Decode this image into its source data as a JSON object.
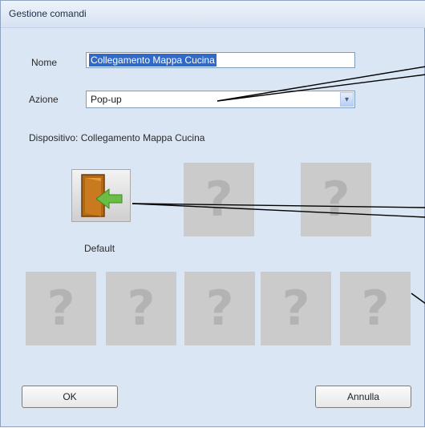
{
  "window": {
    "title": "Gestione comandi"
  },
  "form": {
    "nome_label": "Nome",
    "nome_value": "Collegamento Mappa Cucina",
    "azione_label": "Azione",
    "azione_value": "Pop-up",
    "dispositivo_text": "Dispositivo: Collegamento Mappa Cucina"
  },
  "icons": {
    "default_label": "Default",
    "placeholder_glyph": "?",
    "dropdown_glyph": "▾"
  },
  "buttons": {
    "ok": "OK",
    "annulla": "Annulla"
  }
}
